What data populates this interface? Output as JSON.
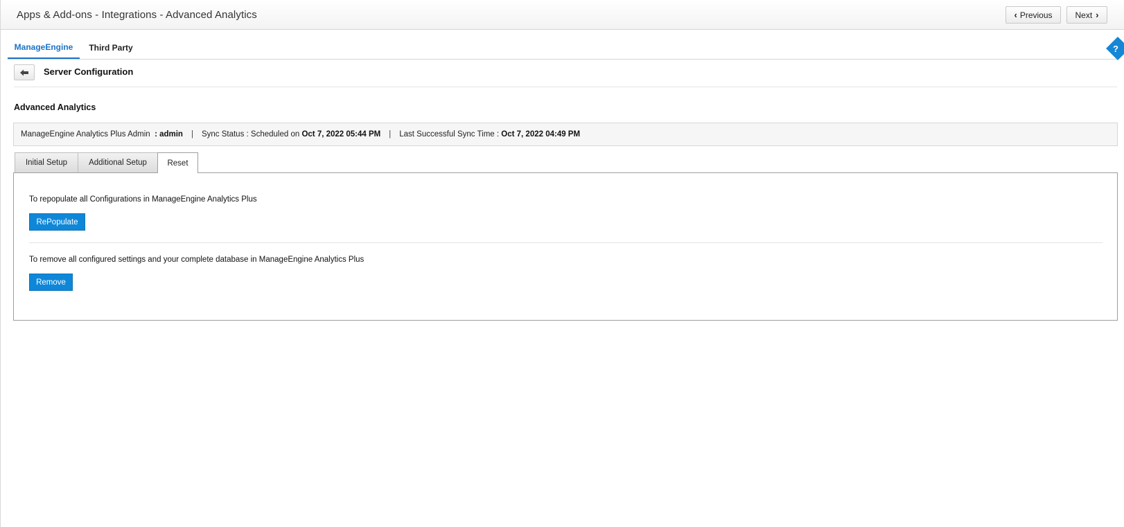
{
  "header": {
    "title": "Apps & Add-ons - Integrations - Advanced Analytics",
    "previous_label": "Previous",
    "next_label": "Next"
  },
  "top_tabs": [
    {
      "label": "ManageEngine",
      "active": true
    },
    {
      "label": "Third Party",
      "active": false
    }
  ],
  "help": {
    "label": "?"
  },
  "section": {
    "title": "Server Configuration",
    "subtitle": "Advanced Analytics"
  },
  "info_bar": {
    "admin_label": "ManageEngine Analytics Plus Admin",
    "admin_value": ": admin",
    "separator": "|",
    "sync_status_label": "Sync Status : Scheduled on",
    "sync_status_value": "Oct 7, 2022 05:44 PM",
    "last_sync_label": "Last Successful Sync Time :",
    "last_sync_value": "Oct 7, 2022 04:49 PM"
  },
  "inner_tabs": [
    {
      "label": "Initial Setup",
      "active": false
    },
    {
      "label": "Additional Setup",
      "active": false
    },
    {
      "label": "Reset",
      "active": true
    }
  ],
  "reset_panel": {
    "repopulate_text": "To repopulate all Configurations in ManageEngine Analytics Plus",
    "repopulate_label": "RePopulate",
    "remove_text": "To remove all configured settings and your complete database in ManageEngine Analytics Plus",
    "remove_label": "Remove"
  },
  "colors": {
    "accent": "#1a73c8",
    "primary_button": "#0f87d8"
  }
}
